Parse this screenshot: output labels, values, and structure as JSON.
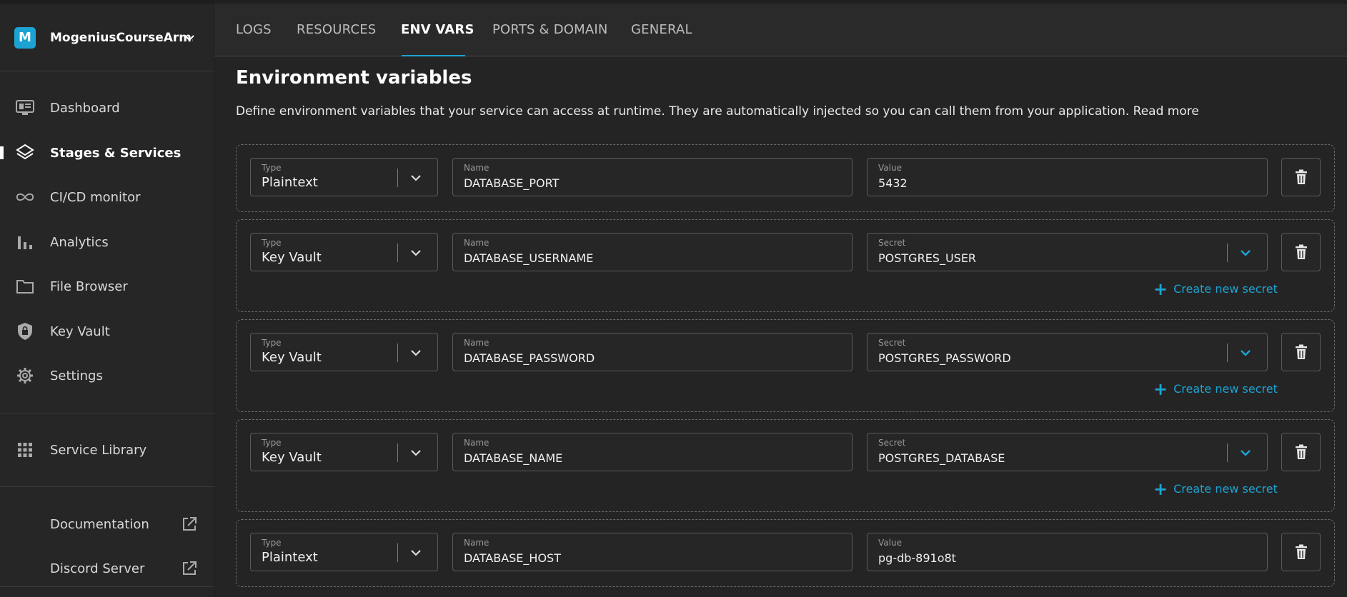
{
  "org": {
    "badge": "M",
    "name": "MogeniusCourseArm..."
  },
  "sidebar": {
    "items": [
      {
        "label": "Dashboard",
        "icon": "monitor-icon"
      },
      {
        "label": "Stages & Services",
        "icon": "layers-icon",
        "active": true
      },
      {
        "label": "CI/CD monitor",
        "icon": "infinity-icon"
      },
      {
        "label": "Analytics",
        "icon": "bar-chart-icon"
      },
      {
        "label": "File Browser",
        "icon": "folder-icon"
      },
      {
        "label": "Key Vault",
        "icon": "shield-lock-icon"
      },
      {
        "label": "Settings",
        "icon": "gear-icon"
      }
    ],
    "library": {
      "label": "Service Library",
      "icon": "grid-icon"
    },
    "external": [
      {
        "label": "Documentation",
        "icon": "external-link-icon"
      },
      {
        "label": "Discord Server",
        "icon": "external-link-icon"
      }
    ]
  },
  "tabs": [
    "LOGS",
    "RESOURCES",
    "ENV VARS",
    "PORTS & DOMAIN",
    "GENERAL"
  ],
  "active_tab": "ENV VARS",
  "page": {
    "title": "Environment variables",
    "description": "Define environment variables that your service can access at runtime. They are automatically injected so you can call them from your application.",
    "read_more": "Read more"
  },
  "labels": {
    "type": "Type",
    "name": "Name",
    "value": "Value",
    "secret": "Secret",
    "create_secret": "Create new secret"
  },
  "env_vars": [
    {
      "type": "Plaintext",
      "name": "DATABASE_PORT",
      "value_label": "Value",
      "value": "5432"
    },
    {
      "type": "Key Vault",
      "name": "DATABASE_USERNAME",
      "value_label": "Secret",
      "value": "POSTGRES_USER"
    },
    {
      "type": "Key Vault",
      "name": "DATABASE_PASSWORD",
      "value_label": "Secret",
      "value": "POSTGRES_PASSWORD"
    },
    {
      "type": "Key Vault",
      "name": "DATABASE_NAME",
      "value_label": "Secret",
      "value": "POSTGRES_DATABASE"
    },
    {
      "type": "Plaintext",
      "name": "DATABASE_HOST",
      "value_label": "Value",
      "value": "pg-db-891o8t"
    }
  ],
  "colors": {
    "accent": "#1ca3d3",
    "background": "#242424",
    "sidebar": "#262626"
  }
}
